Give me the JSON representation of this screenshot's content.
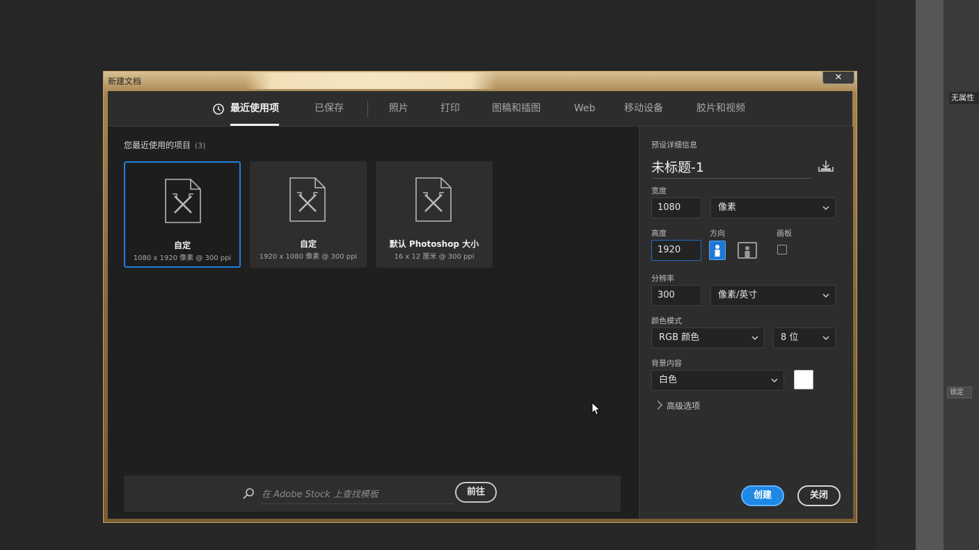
{
  "dialog": {
    "title": "新建文档",
    "close_symbol": "✕"
  },
  "tabs": [
    {
      "label": "最近使用项",
      "active": true
    },
    {
      "label": "已保存",
      "active": false
    },
    {
      "label": "照片",
      "active": false
    },
    {
      "label": "打印",
      "active": false
    },
    {
      "label": "图稿和插图",
      "active": false
    },
    {
      "label": "Web",
      "active": false
    },
    {
      "label": "移动设备",
      "active": false
    },
    {
      "label": "胶片和视频",
      "active": false
    }
  ],
  "recent": {
    "title": "您最近使用的项目",
    "count": "(3)",
    "items": [
      {
        "name": "自定",
        "meta": "1080 x 1920 像素 @ 300 ppi",
        "selected": true
      },
      {
        "name": "自定",
        "meta": "1920 x 1080 像素 @ 300 ppi",
        "selected": false
      },
      {
        "name": "默认 Photoshop 大小",
        "meta": "16 x 12 厘米 @ 300 ppi",
        "selected": false
      }
    ]
  },
  "search": {
    "placeholder": "在 Adobe Stock 上查找模板",
    "go_label": "前往"
  },
  "preset": {
    "section_label": "预设详细信息",
    "doc_name": "未标题-1",
    "width_label": "宽度",
    "width_value": "1080",
    "width_unit": "像素",
    "height_label": "高度",
    "height_value": "1920",
    "orientation_label": "方向",
    "artboard_label": "画板",
    "resolution_label": "分辨率",
    "resolution_value": "300",
    "resolution_unit": "像素/英寸",
    "color_mode_label": "颜色模式",
    "color_mode": "RGB 颜色",
    "bit_depth": "8 位",
    "background_label": "背景内容",
    "background": "白色",
    "background_color": "#ffffff",
    "advanced_label": "高级选项"
  },
  "actions": {
    "create_label": "创建",
    "close_label": "关闭"
  },
  "side": {
    "no_attr": "无属性",
    "lock": "锁定"
  },
  "colors": {
    "accent": "#1e88e5",
    "selection": "#1f7fe0"
  }
}
